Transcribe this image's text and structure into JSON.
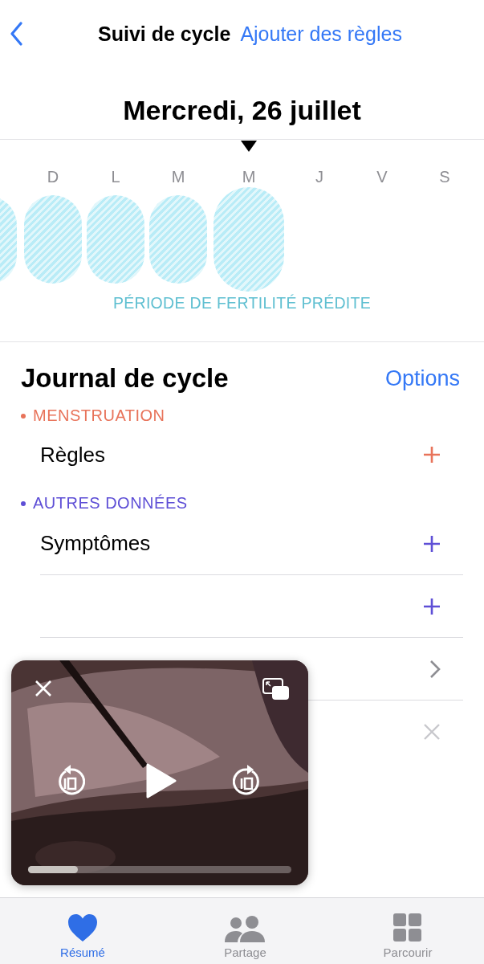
{
  "nav": {
    "title": "Suivi de cycle",
    "action": "Ajouter des règles"
  },
  "date_title": "Mercredi, 26 juillet",
  "week": {
    "previous_fertile": true,
    "days": [
      {
        "letter": "D",
        "fertile": true,
        "selected": false
      },
      {
        "letter": "L",
        "fertile": true,
        "selected": false
      },
      {
        "letter": "M",
        "fertile": true,
        "selected": false
      },
      {
        "letter": "M",
        "fertile": true,
        "selected": true
      },
      {
        "letter": "J",
        "fertile": false,
        "selected": false
      },
      {
        "letter": "V",
        "fertile": false,
        "selected": false
      },
      {
        "letter": "S",
        "fertile": false,
        "selected": false
      }
    ],
    "legend": "PÉRIODE DE FERTILITÉ PRÉDITE"
  },
  "journal": {
    "title": "Journal de cycle",
    "options": "Options",
    "sections": [
      {
        "title": "MENSTRUATION",
        "color": "#e8735a",
        "rows": [
          {
            "label": "Règles",
            "kind": "plus"
          }
        ]
      },
      {
        "title": "AUTRES DONNÉES",
        "color": "#5e4fd6",
        "rows": [
          {
            "label": "Symptômes",
            "kind": "plus"
          },
          {
            "kind": "plus"
          },
          {
            "kind": "chevron"
          },
          {
            "kind": "close"
          }
        ]
      }
    ]
  },
  "video": {
    "level": 0.19
  },
  "tabs": [
    {
      "label": "Résumé",
      "kind": "heart",
      "selected": true
    },
    {
      "label": "Partage",
      "kind": "people",
      "selected": false
    },
    {
      "label": "Parcourir",
      "kind": "grid",
      "selected": false
    }
  ]
}
